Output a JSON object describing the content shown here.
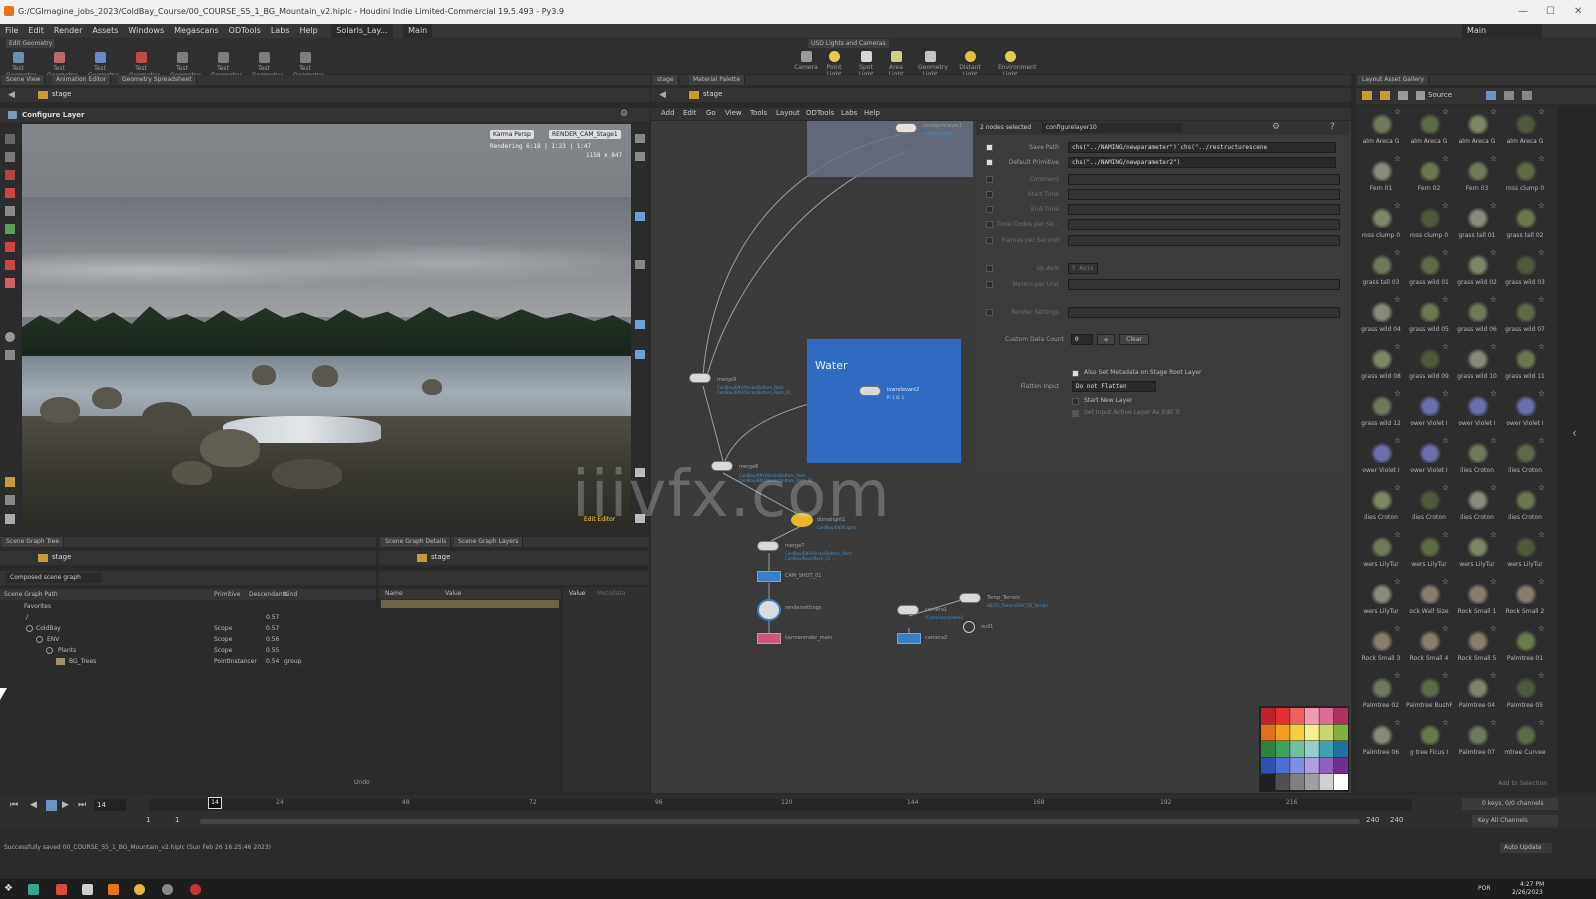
{
  "window": {
    "title": "G:/CGImagine_jobs_2023/ColdBay_Course/00_COURSE_S5_1_BG_Mountain_v2.hiplc - Houdini Indie Limited-Commercial 19.5.493 - Py3.9",
    "minimize": "—",
    "maximize": "☐",
    "close": "✕"
  },
  "menu": {
    "items": [
      "File",
      "Edit",
      "Render",
      "Assets",
      "Windows",
      "Megascans",
      "ODTools",
      "Labs",
      "Help"
    ],
    "desktop": "Solaris_Lay...",
    "main": "Main",
    "right_desktop": "Main"
  },
  "shelf_left": {
    "tab": "Edit Geometry",
    "tools": [
      "Test Geometry: S",
      "Test Geometry: B",
      "Test Geometry: K",
      "Test Geometry: P",
      "Test Geometry: T",
      "Test Geometry: S",
      "Test Geometry: S",
      "Test Geometry: T",
      "Test Geometry: S"
    ]
  },
  "shelf_right": {
    "tab": "USD Lights and Cameras",
    "tools": [
      "Camera",
      "Point Light",
      "Spot Light",
      "Area Light",
      "Geometry Light",
      "Distant Light",
      "Environment Light"
    ]
  },
  "scene_view": {
    "tabs": [
      "Scene View",
      "Animation Editor",
      "Geometry Spreadsheet"
    ],
    "path": "stage",
    "title": "Configure Layer",
    "camera_menu": "Karma Persp",
    "render_menu": "RENDER_CAM_Stage1",
    "hud_lines": [
      "Rendering  6:18  |  1:23 | 1:47",
      "1158 x 847"
    ],
    "bottom_hint": "Edit Editor"
  },
  "network": {
    "tabs": [
      "stage",
      "Material Palette"
    ],
    "path": "stage",
    "menu": [
      "Add",
      "Edit",
      "Go",
      "View",
      "Tools",
      "Layout",
      "ODTools",
      "Labs",
      "Help"
    ],
    "backdrop_label": "Water",
    "nodes": [
      {
        "name": "configurelayer1",
        "sub": "configure data"
      },
      {
        "name": "merge9",
        "sub": "ColdBay/ENV/Rocks/Bottom_Rock ColdBay/ENV/Rocks/Bottom_Rock_01"
      },
      {
        "name": "lowrelevant2",
        "sub": "P: 1  Q: 1"
      },
      {
        "name": "merge8",
        "sub": "ColdBay/ENV/Rocks/Bottom_Rock ColdBay/ENV/Rocks/Bottom_Rock_02"
      },
      {
        "name": "domelight1",
        "sub": "ColdBay/ENV/Lights"
      },
      {
        "name": "merge7",
        "sub": "ColdBay/ENV/Rocks/Bottom_Rock ColdBay/Rock/Rock_01 ..."
      },
      {
        "name": "CAM_SHOT_01",
        "sub": ""
      },
      {
        "name": "rendersettings",
        "sub": "Rendersettings"
      },
      {
        "name": "karmarender_main",
        "sub": ""
      },
      {
        "name": "camera1",
        "sub": "/Cameras/camera1"
      },
      {
        "name": "Temp_Terrain",
        "sub": "HE/TO_Terrain/ENV_TO_Terrain"
      },
      {
        "name": "null1",
        "sub": ""
      },
      {
        "name": "camera2",
        "sub": ""
      }
    ]
  },
  "params": {
    "header": "2 nodes selected",
    "node": "configurelayer10",
    "rows": [
      {
        "label": "Save Path",
        "value": "chs(\"../NAMING/newparameter\")`chs(\"../restructurescene",
        "checked": true
      },
      {
        "label": "Default Primitive",
        "value": "chs(\"../NAMING/newparameter2\")",
        "checked": true
      },
      {
        "label": "Comment",
        "value": "",
        "checked": false
      },
      {
        "label": "Start Time",
        "value": "",
        "checked": false
      },
      {
        "label": "End Time",
        "value": "",
        "checked": false
      },
      {
        "label": "Time Codes per Se...",
        "value": "",
        "checked": false
      },
      {
        "label": "Frames per Second",
        "value": "",
        "checked": false
      },
      {
        "label": "Up Axis",
        "value": "Y Axis",
        "checked": false
      },
      {
        "label": "Meters per Unit",
        "value": "",
        "checked": false
      },
      {
        "label": "Render Settings",
        "value": "",
        "checked": false
      }
    ],
    "custom_data_label": "Custom Data Count",
    "custom_data_value": "0",
    "clear_label": "Clear",
    "also_set_metadata": "Also Set Metadata on Stage Root Layer",
    "flatten_label": "Flatten Input",
    "flatten_value": "Do not Flatten",
    "start_new_layer": "Start New Layer",
    "set_edit_target": "Set Input Active Layer As Edit Tr"
  },
  "gallery": {
    "tab": "Layout Asset Gallery",
    "source_label": "Source",
    "items": [
      "alm Areca G",
      "alm Areca G",
      "alm Areca G",
      "alm Areca G",
      "Fern 01",
      "Fern 02",
      "Fern 03",
      "ross clump 0",
      "ross clump 0",
      "ross clump 0",
      "grass tall 01",
      "grass tall 02",
      "grass tall 03",
      "grass wild 01",
      "grass wild 02",
      "grass wild 03",
      "grass wild 04",
      "grass wild 05",
      "grass wild 06",
      "grass wild 07",
      "grass wild 08",
      "grass wild 09",
      "grass wild 10",
      "grass wild 11",
      "grass wild 12",
      "ower Violet I",
      "ower Violet I",
      "ower Violet I",
      "ower Violet I",
      "ower Violet I",
      "ilies Croton",
      "ilies Croton",
      "ilies Croton",
      "ilies Croton",
      "ilies Croton",
      "ilies Croton",
      "wers LilyTur",
      "wers LilyTur",
      "wers LilyTur",
      "wers LilyTur",
      "wers LilyTur",
      "ock Wall Size",
      "Rock Small 1",
      "Rock Small 2",
      "Rock Small 3",
      "Rock Small 4",
      "Rock Small 5",
      "Palmtree 01",
      "Palmtree 02",
      "Palmtree BushPa",
      "Palmtree 04",
      "Palmtree 05",
      "Palmtree 06",
      "g tree Ficus I",
      "Palmtree 07",
      "mtree Curvee"
    ],
    "footer": "Add to Selection"
  },
  "scene_graph_tree": {
    "tabs": [
      "Scene Graph Tree"
    ],
    "path": "stage",
    "filter": "Composed scene graph",
    "columns": [
      "Scene Graph Path",
      "Primitive",
      "Descendants",
      "Kind"
    ],
    "rows": [
      {
        "name": "Favorites",
        "type": "",
        "count": "",
        "kind": "",
        "indent": 0
      },
      {
        "name": "/",
        "type": "",
        "count": "0.57",
        "kind": "",
        "indent": 0
      },
      {
        "name": "ColdBay",
        "type": "Scope",
        "count": "0.57",
        "kind": "",
        "indent": 1
      },
      {
        "name": "ENV",
        "type": "Scope",
        "count": "0.56",
        "kind": "",
        "indent": 2
      },
      {
        "name": "Plants",
        "type": "Scope",
        "count": "0.55",
        "kind": "",
        "indent": 3
      },
      {
        "name": "BG_Trees",
        "type": "PointInstancer",
        "count": "0.54",
        "kind": "group",
        "indent": 4
      }
    ],
    "footer": "Undo"
  },
  "scene_graph_details": {
    "tabs": [
      "Scene Graph Details",
      "Scene Graph Layers"
    ],
    "path": "stage",
    "columns": [
      "Name",
      "Value"
    ],
    "value_tab": "Value",
    "metadata_tab": "Metadata"
  },
  "timeline": {
    "current_frame": "14",
    "start": "1",
    "start2": "1",
    "end": "240",
    "end2": "240",
    "ticks": [
      "24",
      "48",
      "72",
      "96",
      "120",
      "144",
      "168",
      "192",
      "216"
    ],
    "keys_label": "0 keys, 0/0 channels",
    "key_all": "Key All Channels",
    "auto_update": "Auto Update",
    "status_bar": "Successfully saved 00_COURSE_S5_1_BG_Mountain_v2.hiplc (Sun Feb 26 16:25:46 2023)"
  },
  "watermark": "iiivfx.com",
  "taskbar": {
    "lang": "POR",
    "time": "4:27 PM",
    "date": "2/26/2023"
  }
}
